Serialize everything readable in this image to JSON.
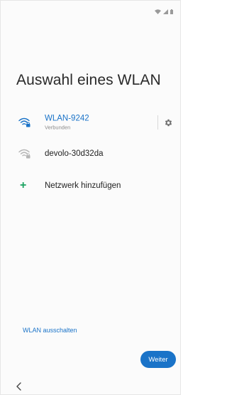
{
  "page": {
    "title": "Auswahl eines WLAN"
  },
  "networks": [
    {
      "name": "WLAN-9242",
      "status": "Verbunden",
      "connected": true,
      "icon": "wifi-lock-icon"
    },
    {
      "name": "devolo-30d32da",
      "status": "",
      "connected": false,
      "icon": "wifi-lock-icon"
    }
  ],
  "add_network": {
    "label": "Netzwerk hinzufügen",
    "icon": "plus-icon"
  },
  "footer": {
    "wlan_off_label": "WLAN ausschalten",
    "next_label": "Weiter"
  },
  "colors": {
    "accent": "#1a73c8",
    "add_icon": "#1aa260"
  }
}
